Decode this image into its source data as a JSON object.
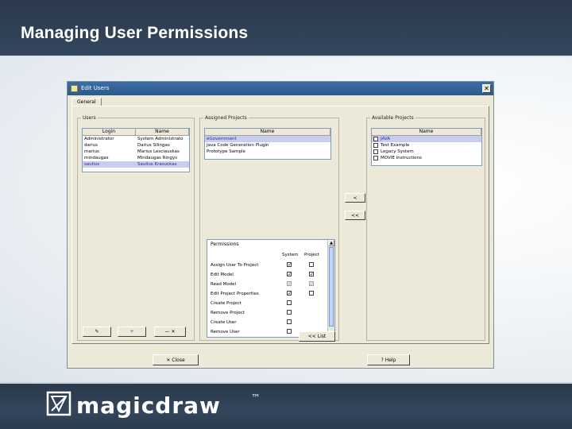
{
  "slide": {
    "title": "Managing User Permissions",
    "logo_text": "magicdraw",
    "logo_tm": "™"
  },
  "dialog": {
    "title": "Edit Users",
    "close_glyph": "✕",
    "tab_label": "General",
    "users": {
      "group_label": "Users",
      "columns": [
        "Login",
        "Name"
      ],
      "rows": [
        {
          "login": "Administrator",
          "name": "System Administrato"
        },
        {
          "login": "darius",
          "name": "Darius Silingas"
        },
        {
          "login": "marius",
          "name": "Marius Lesciauskas"
        },
        {
          "login": "mindaugas",
          "name": "Mindaugas Ringys"
        },
        {
          "login": "saulius",
          "name": "Saulius Krasuckas"
        }
      ],
      "buttons": {
        "edit": "✎",
        "add": "+",
        "delete": "— ✕"
      }
    },
    "assigned": {
      "group_label": "Assigned Projects",
      "column": "Name",
      "rows": [
        "eGovernment",
        "Java Code Generation Plugin",
        "Prototype Sample"
      ],
      "permissions_label": "Permissions",
      "col_system": "System",
      "col_project": "Project",
      "permissions": [
        {
          "name": "Assign User To Project",
          "system": "✓",
          "project": ""
        },
        {
          "name": "Edit Model",
          "system": "✓",
          "project": "✓"
        },
        {
          "name": "Read Model",
          "system": "✓",
          "project": "✓"
        },
        {
          "name": "Edit Project Properties",
          "system": "✓",
          "project": ""
        },
        {
          "name": "Create Project",
          "system": "",
          "project": ""
        },
        {
          "name": "Remove Project",
          "system": "",
          "project": ""
        },
        {
          "name": "Create User",
          "system": "",
          "project": ""
        },
        {
          "name": "Remove User",
          "system": "",
          "project": ""
        }
      ],
      "add_arrow": "<",
      "remove_arrow": "<<",
      "list_button": "<< List"
    },
    "available": {
      "group_label": "Available Projects",
      "column": "Name",
      "rows": [
        "JAVA",
        "Test Example",
        "Legacy System",
        "MOVIE Instructions"
      ]
    },
    "close_button": "✕  Close",
    "help_button": "?  Help"
  }
}
